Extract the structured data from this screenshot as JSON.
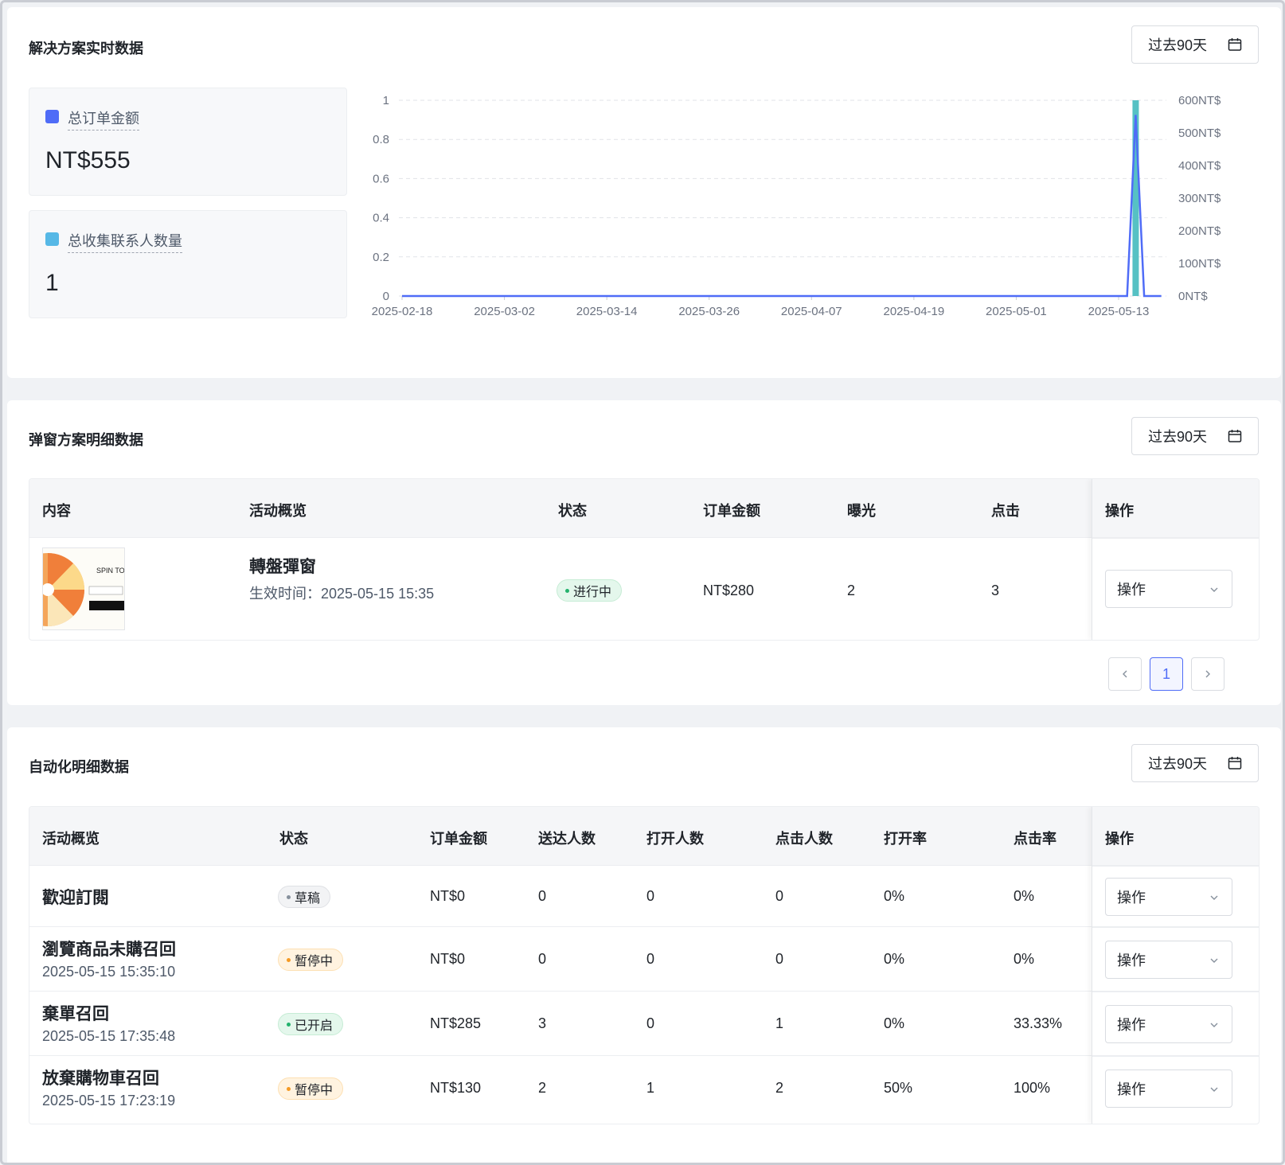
{
  "realtime": {
    "title": "解决方案实时数据",
    "date_range": "过去90天",
    "stats": [
      {
        "label": "总订单金额",
        "value": "NT$555",
        "color": "#4f6cf7"
      },
      {
        "label": "总收集联系人数量",
        "value": "1",
        "color": "#56b8e6"
      }
    ]
  },
  "chart_data": {
    "type": "line",
    "x": [
      "2025-02-18",
      "2025-03-02",
      "2025-03-14",
      "2025-03-26",
      "2025-04-07",
      "2025-04-19",
      "2025-05-01",
      "2025-05-13"
    ],
    "y_left_ticks": [
      "1",
      "0.8",
      "0.6",
      "0.4",
      "0.2",
      "0"
    ],
    "y_right_ticks": [
      "600NT$",
      "500NT$",
      "400NT$",
      "300NT$",
      "200NT$",
      "100NT$",
      "0NT$"
    ],
    "ylim_left": [
      0,
      1
    ],
    "ylim_right": [
      0,
      600
    ],
    "series": [
      {
        "color": "#4f6cf7",
        "axis": "right",
        "points": [
          [
            "2025-02-18",
            0
          ],
          [
            "2025-05-14",
            0
          ],
          [
            "2025-05-15",
            555
          ],
          [
            "2025-05-16",
            0
          ],
          [
            "2025-05-18",
            0
          ]
        ]
      },
      {
        "color": "#56c1c4",
        "axis": "left",
        "type": "bar",
        "points": [
          [
            "2025-05-15",
            1
          ]
        ]
      }
    ],
    "grid": true
  },
  "popup": {
    "title": "弹窗方案明细数据",
    "date_range": "过去90天",
    "headers": [
      "内容",
      "活动概览",
      "状态",
      "订单金额",
      "曝光",
      "点击",
      "操作"
    ],
    "rows": [
      {
        "thumb_text": "SPIN TO",
        "name": "轉盤彈窗",
        "sub": "生效时间：2025-05-15 15:35",
        "status": "进行中",
        "amount": "NT$280",
        "exposure": "2",
        "clicks": "3",
        "action": "操作"
      }
    ],
    "page": "1"
  },
  "automation": {
    "title": "自动化明细数据",
    "date_range": "过去90天",
    "headers": [
      "活动概览",
      "状态",
      "订单金额",
      "送达人数",
      "打开人数",
      "点击人数",
      "打开率",
      "点击率",
      "操作"
    ],
    "rows": [
      {
        "name": "歡迎訂閱",
        "sub": "",
        "status": "草稿",
        "amount": "NT$0",
        "delivered": "0",
        "opened": "0",
        "clicked": "0",
        "open_rate": "0%",
        "click_rate": "0%",
        "action": "操作"
      },
      {
        "name": "瀏覽商品未購召回",
        "sub": "2025-05-15 15:35:10",
        "status": "暂停中",
        "amount": "NT$0",
        "delivered": "0",
        "opened": "0",
        "clicked": "0",
        "open_rate": "0%",
        "click_rate": "0%",
        "action": "操作"
      },
      {
        "name": "棄單召回",
        "sub": "2025-05-15 17:35:48",
        "status": "已开启",
        "amount": "NT$285",
        "delivered": "3",
        "opened": "0",
        "clicked": "1",
        "open_rate": "0%",
        "click_rate": "33.33%",
        "action": "操作"
      },
      {
        "name": "放棄購物車召回",
        "sub": "2025-05-15 17:23:19",
        "status": "暂停中",
        "amount": "NT$130",
        "delivered": "2",
        "opened": "1",
        "clicked": "2",
        "open_rate": "50%",
        "click_rate": "100%",
        "action": "操作"
      }
    ]
  }
}
